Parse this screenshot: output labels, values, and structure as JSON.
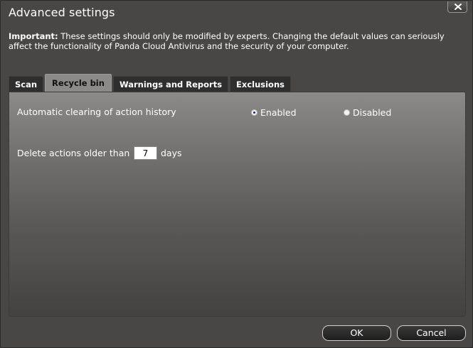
{
  "window": {
    "title": "Advanced settings"
  },
  "notice": {
    "bold": "Important:",
    "text": " These settings should only be modified by experts. Changing the default values can seriously affect the functionality of Panda Cloud Antivirus and the security of your computer."
  },
  "tabs": [
    {
      "label": "Scan",
      "active": false
    },
    {
      "label": "Recycle bin",
      "active": true
    },
    {
      "label": "Warnings and Reports",
      "active": false
    },
    {
      "label": "Exclusions",
      "active": false
    }
  ],
  "recycle": {
    "auto_clear_label": "Automatic clearing of action history",
    "enabled_label": "Enabled",
    "disabled_label": "Disabled",
    "selected": "Enabled",
    "delete_prefix": "Delete actions older than",
    "days_value": "7",
    "days_suffix": "days"
  },
  "buttons": {
    "ok": "OK",
    "cancel": "Cancel"
  },
  "icons": {
    "close": "close-icon"
  }
}
